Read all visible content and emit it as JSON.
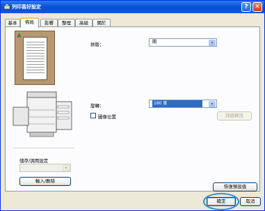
{
  "window": {
    "title": "列印喜好設定"
  },
  "tabs": [
    {
      "label": "基本"
    },
    {
      "label": "佈局"
    },
    {
      "label": "影響"
    },
    {
      "label": "整理"
    },
    {
      "label": "高級"
    },
    {
      "label": "關於"
    }
  ],
  "active_tab": "佈局",
  "layout": {
    "pages_label": "拼版：",
    "pages_value": "關",
    "rotate_label": "旋轉：",
    "rotate_value": "180 度",
    "image_position_label": "圖像位置",
    "image_position_checked": false,
    "details_button": "詳細資訊"
  },
  "saved_settings": {
    "label": "儲存/調用設定",
    "value": "",
    "input_delete_button": "輸入/刪除"
  },
  "restore_defaults_button": "恢復預設值",
  "ok_button": "確定",
  "cancel_button": "取消",
  "colors": {
    "titlebar": "#0a56d8",
    "accent_tab": "#ffc83c",
    "highlight_ring": "#2a8fd6",
    "selection": "#316ac5"
  }
}
